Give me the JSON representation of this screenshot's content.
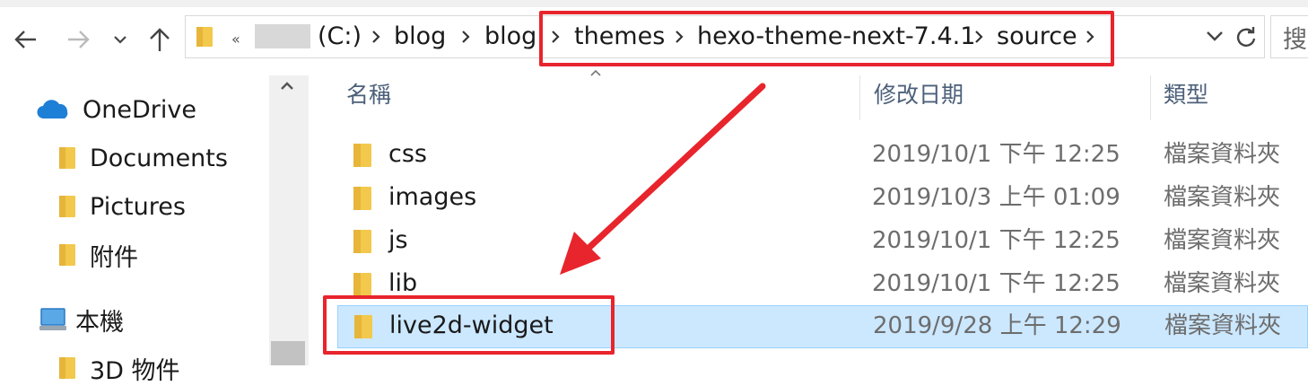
{
  "breadcrumb": {
    "overflow": "«",
    "items": [
      "(C:)",
      "blog",
      "blog",
      "themes",
      "hexo-theme-next-7.4.1",
      "source"
    ]
  },
  "search": {
    "placeholder": "搜"
  },
  "sidebar": {
    "items": [
      {
        "label": "OneDrive",
        "icon": "onedrive-icon"
      },
      {
        "label": "Documents",
        "icon": "folder-icon"
      },
      {
        "label": "Pictures",
        "icon": "folder-icon"
      },
      {
        "label": "附件",
        "icon": "folder-icon"
      },
      {
        "label": "本機",
        "icon": "computer-icon"
      },
      {
        "label": "3D 物件",
        "icon": "folder-icon"
      }
    ]
  },
  "columns": {
    "name": "名稱",
    "date": "修改日期",
    "type": "類型"
  },
  "files": [
    {
      "name": "css",
      "date": "2019/10/1 下午 12:25",
      "type": "檔案資料夾"
    },
    {
      "name": "images",
      "date": "2019/10/3 上午 01:09",
      "type": "檔案資料夾"
    },
    {
      "name": "js",
      "date": "2019/10/1 下午 12:25",
      "type": "檔案資料夾"
    },
    {
      "name": "lib",
      "date": "2019/10/1 下午 12:25",
      "type": "檔案資料夾"
    },
    {
      "name": "live2d-widget",
      "date": "2019/9/28 上午 12:29",
      "type": "檔案資料夾",
      "selected": true
    }
  ],
  "colors": {
    "highlight": "#e8242c",
    "selection": "#cce8ff",
    "folder": "#f2c94c"
  }
}
